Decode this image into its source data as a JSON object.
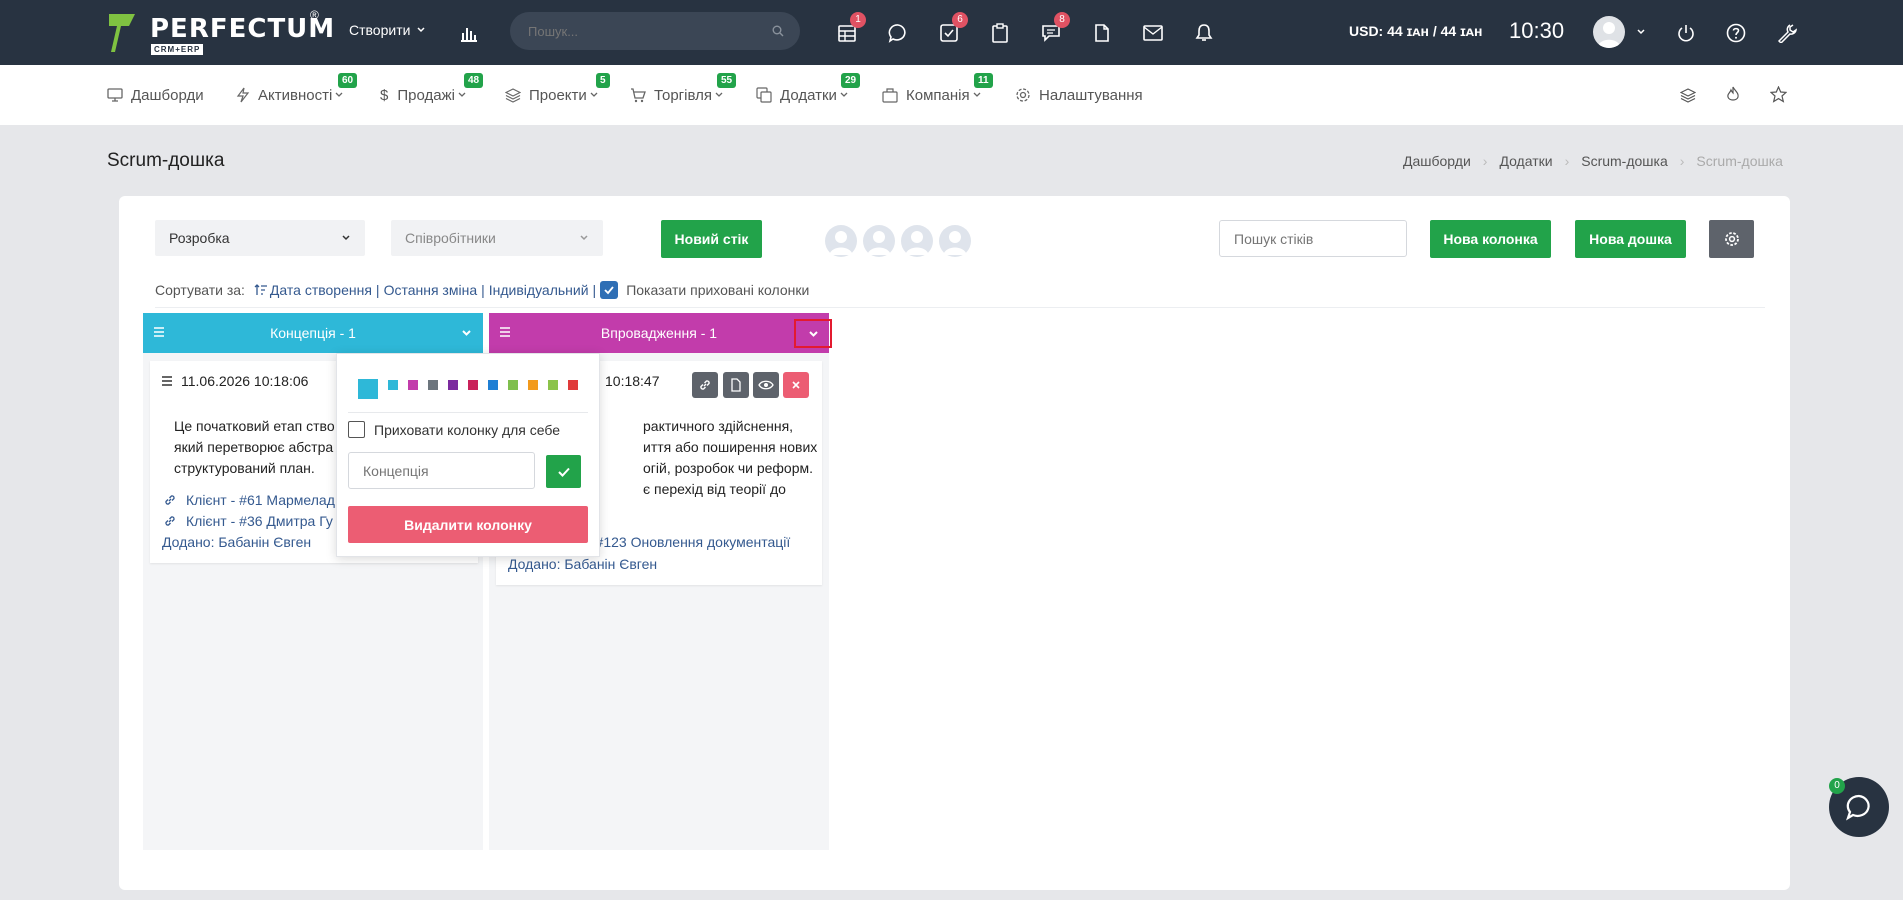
{
  "topbar": {
    "brand": "PERFECTUM",
    "brand_sub": "CRM+ERP",
    "registered": "®",
    "create_label": "Створити",
    "search_placeholder": "Пошук...",
    "badges": {
      "tasks": "1",
      "todo": "6",
      "tickets": "8"
    },
    "currency": "USD: 44 ɪᴀʜ / 44 ɪᴀʜ",
    "time": "10:30"
  },
  "menu": {
    "items": [
      {
        "label": "Дашборди",
        "badge": ""
      },
      {
        "label": "Активності",
        "badge": "60"
      },
      {
        "label": "Продажі",
        "badge": "48"
      },
      {
        "label": "Проекти",
        "badge": "5"
      },
      {
        "label": "Торгівля",
        "badge": "55"
      },
      {
        "label": "Додатки",
        "badge": "29"
      },
      {
        "label": "Компанія",
        "badge": "11"
      },
      {
        "label": "Налаштування",
        "badge": ""
      }
    ]
  },
  "page": {
    "title": "Scrum-дошка",
    "breadcrumb": [
      "Дашборди",
      "Додатки",
      "Scrum-дошка",
      "Scrum-дошка"
    ]
  },
  "toolbar": {
    "board_select": "Розробка",
    "staff_select": "Співробітники",
    "new_sticker": "Новий стік",
    "search_placeholder": "Пошук стіків",
    "new_column": "Нова колонка",
    "new_board": "Нова дошка"
  },
  "sort": {
    "label": "Сортувати за:",
    "created": "Дата створення",
    "changed": "Остання зміна",
    "individual": "Індивідуальний",
    "sep": "|",
    "show_hidden": "Показати приховані колонки"
  },
  "columns": [
    {
      "title": "Концепція",
      "count": " - 1",
      "color": "#2eb8d8",
      "card": {
        "date": "11.06.2026 10:18:06",
        "text": [
          "Це початковий етап ство",
          "який перетворює абстра",
          "структурований план."
        ],
        "links": [
          "Клієнт - #61 Мармелад",
          "Клієнт - #36 Дмитра Гу"
        ],
        "added": "Додано: Бабанін Євген"
      }
    },
    {
      "title": "Впровадження",
      "count": " - 1",
      "color": "#c23cab",
      "card": {
        "date": "10:18:47",
        "text": [
          "рактичного здійснення,",
          "иття або поширення нових",
          "огій, розробок чи реформ.",
          "є перехід від теорії до"
        ],
        "links": [
          "- #123 Оновлення документації"
        ],
        "added": "Додано: Бабанін Євген"
      }
    }
  ],
  "popup": {
    "colors": [
      "#2eb8d8",
      "#2eb8d8",
      "#c23cab",
      "#6c757d",
      "#7b2a9e",
      "#c9215a",
      "#1f7fd4",
      "#7fbf4d",
      "#f29a1c",
      "#8bc34a",
      "#e03a3a"
    ],
    "hide_label": "Приховати колонку для себе",
    "name_placeholder": "Концепція",
    "delete_label": "Видалити колонку"
  },
  "chat": {
    "badge": "0"
  }
}
